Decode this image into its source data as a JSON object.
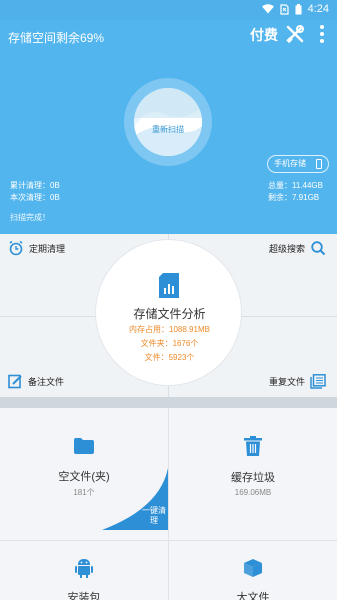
{
  "status_bar": {
    "time": "4:24",
    "icons": [
      "wifi-icon",
      "no-sim-icon",
      "battery-icon"
    ]
  },
  "header": {
    "title": "存储空间剩余69%",
    "pay_label": "付费",
    "tools_icon": "tools-icon",
    "more_icon": "more-vert-icon",
    "rescan_label": "重新扫描",
    "phone_storage_label": "手机存储",
    "cumulative_clean": "累计清理：0B",
    "this_clean": "本次清理：0B",
    "total": "总量：11.44GB",
    "remaining": "剩余：7.91GB",
    "scan_status": "扫描完成！",
    "color": "#53b5ee"
  },
  "analysis": {
    "title": "存储文件分析",
    "memory": "内存占用：1088.91MB",
    "folders": "文件夹：1676个",
    "files": "文件：5923个",
    "scheduled_clean": "定期清理",
    "super_search": "超级搜索",
    "notes_files": "备注文件",
    "duplicate_files": "重复文件",
    "accent": "#ee8a2a"
  },
  "bottom": {
    "empty_folders_label": "空文件(夹)",
    "empty_folders_count": "181个",
    "cache_label": "缓存垃圾",
    "cache_size": "169.06MB",
    "one_key_clean": "一键清理",
    "apk_label": "安装包",
    "big_files_label": "大文件"
  }
}
